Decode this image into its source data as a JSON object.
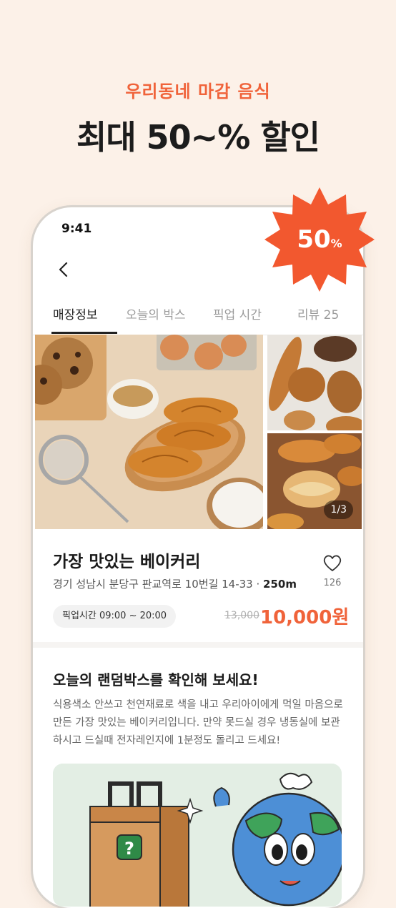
{
  "hero": {
    "subtitle": "우리동네 마감 음식",
    "title": "최대 50~% 할인"
  },
  "badge": {
    "value": "50",
    "unit": "%"
  },
  "status_bar": {
    "time": "9:41"
  },
  "tabs": [
    {
      "label": "매장정보",
      "active": true
    },
    {
      "label": "오늘의 박스",
      "active": false
    },
    {
      "label": "픽업 시간",
      "active": false
    },
    {
      "label": "리뷰 25",
      "active": false
    }
  ],
  "gallery": {
    "counter": "1/3"
  },
  "store": {
    "name": "가장 맛있는 베이커리",
    "address": "경기 성남시 분당구 판교역로 10번길 14-33",
    "distance": "250m",
    "likes": "126",
    "pickup": "픽업시간 09:00 ~ 20:00",
    "original_price": "13,000",
    "price": "10,000원"
  },
  "random_box": {
    "title": "오늘의 랜덤박스를 확인해 보세요!",
    "description": "식용색소 안쓰고 천연재료로 색을 내고 우리아이에게 먹일 마음으로 만든 가장 맛있는 베이커리입니다. 만약 못드실 경우 냉동실에 보관하시고 드실때 전자레인지에 1분정도 돌리고 드세요!",
    "question_mark": "?"
  },
  "colors": {
    "accent": "#f0633a",
    "background": "#fcf1e8"
  }
}
